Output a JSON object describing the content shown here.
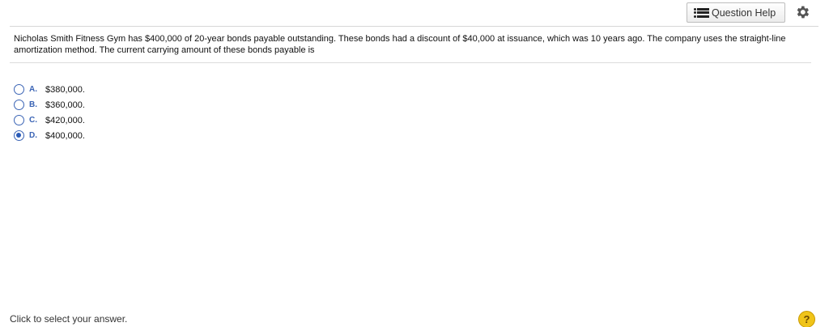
{
  "toolbar": {
    "question_help_label": "Question Help",
    "question_help_icon": "list-icon",
    "settings_icon": "gear-icon"
  },
  "question": {
    "text": "Nicholas Smith Fitness Gym has $400,000 of 20-year bonds payable outstanding. These bonds had a discount of $40,000 at issuance, which was 10 years ago. The company uses the straight-line amortization method. The current carrying amount of these bonds payable is"
  },
  "options": [
    {
      "letter": "A.",
      "text": "$380,000.",
      "selected": false
    },
    {
      "letter": "B.",
      "text": "$360,000.",
      "selected": false
    },
    {
      "letter": "C.",
      "text": "$420,000.",
      "selected": false
    },
    {
      "letter": "D.",
      "text": "$400,000.",
      "selected": true
    }
  ],
  "footer": {
    "instruction": "Click to select your answer.",
    "help_label": "?"
  },
  "colors": {
    "accent": "#3b64b5",
    "help_badge": "#f0c419"
  }
}
